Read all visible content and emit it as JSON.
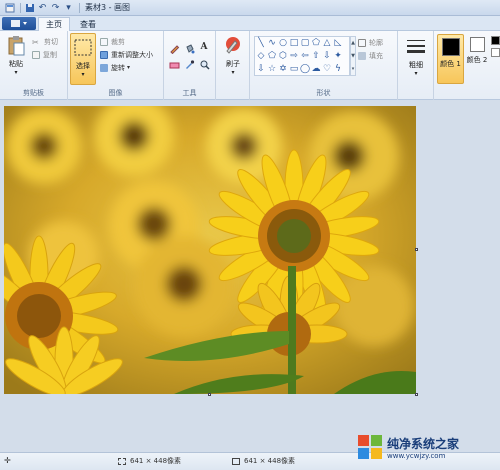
{
  "titlebar": {
    "title": "素材3 - 画图"
  },
  "tabs": {
    "file_label": "",
    "home": "主页",
    "view": "查看"
  },
  "clipboard": {
    "paste": "粘贴",
    "cut": "剪切",
    "copy": "复制",
    "label": "剪贴板"
  },
  "image": {
    "select": "选择",
    "crop": "裁剪",
    "resize": "重新调整大小",
    "rotate": "旋转",
    "label": "图像"
  },
  "tools": {
    "label": "工具",
    "text_tool": "A"
  },
  "brushes": {
    "label": "刷子"
  },
  "shapes": {
    "label": "形状",
    "outline": "轮廓",
    "fill": "填充"
  },
  "size": {
    "label": "粗细"
  },
  "colors": {
    "color1": "颜色 1",
    "color2": "颜色 2",
    "color1_value": "#000000",
    "color2_value": "#ffffff"
  },
  "statusbar": {
    "selection_size": "641 × 448像素",
    "image_size": "641 × 448像素"
  },
  "watermark": {
    "title": "纯净系统之家",
    "url": "www.ycwjzy.com"
  }
}
